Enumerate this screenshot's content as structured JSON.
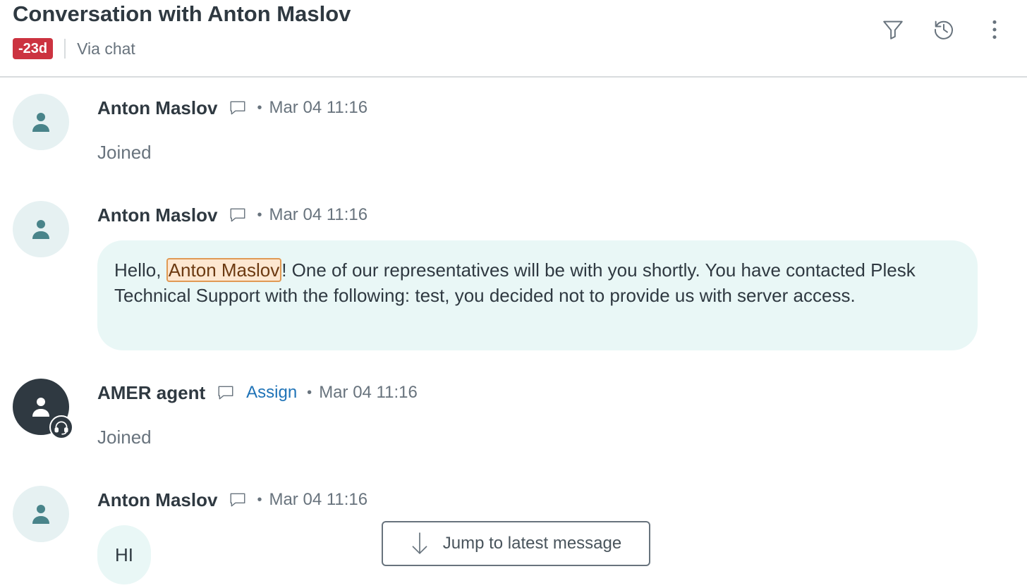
{
  "header": {
    "title": "Conversation with Anton Maslov",
    "sla_badge": "-23d",
    "channel": "Via chat",
    "icons": [
      "filter-icon",
      "history-icon",
      "more-options-icon"
    ]
  },
  "messages": [
    {
      "author": "Anton Maslov",
      "role": "customer",
      "time": "Mar 04 11:16",
      "event": "Joined"
    },
    {
      "author": "Anton Maslov",
      "role": "customer",
      "time": "Mar 04 11:16",
      "text_before": "Hello, ",
      "mention": "Anton Maslov",
      "text_after": "! One of our representatives will be with you shortly. You have contacted Plesk Technical Support with the following: test, you decided not to provide us with server access."
    },
    {
      "author": "AMER agent",
      "role": "agent",
      "action": "Assign",
      "time": "Mar 04 11:16",
      "event": "Joined"
    },
    {
      "author": "Anton Maslov",
      "role": "customer",
      "time": "Mar 04 11:16",
      "text": "HI"
    }
  ],
  "separator_dot": "•",
  "jump_button": {
    "label": "Jump to latest message"
  },
  "colors": {
    "sla_badge": "#cc3340",
    "customer_avatar_bg": "#e6f1f2",
    "agent_avatar_bg": "#2f3941",
    "bubble_bg": "#e9f7f6",
    "mention_bg": "#fde7d1",
    "link": "#1f73b7"
  }
}
